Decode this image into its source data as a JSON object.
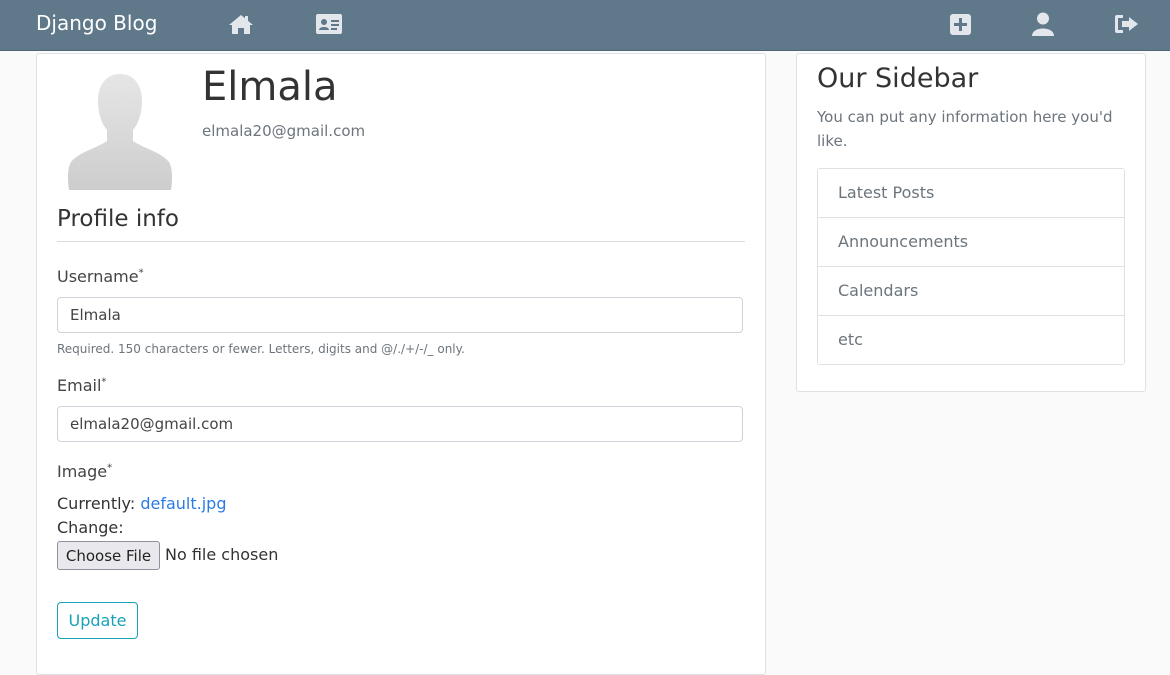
{
  "navbar": {
    "brand": "Django Blog",
    "icons": [
      "home-icon",
      "contact-card-icon",
      "plus-square-icon",
      "user-icon",
      "sign-out-icon"
    ],
    "bg_color": "#5f788a"
  },
  "profile": {
    "name": "Elmala",
    "email": "elmala20@gmail.com"
  },
  "form": {
    "legend": "Profile info",
    "username_label": "Username",
    "required_mark": "*",
    "username_value": "Elmala",
    "username_help": "Required. 150 characters or fewer. Letters, digits and @/./+/-/_ only.",
    "email_label": "Email",
    "email_value": "elmala20@gmail.com",
    "image_label": "Image",
    "currently_label": "Currently:",
    "current_file": "default.jpg",
    "change_label": "Change:",
    "choose_file_label": "Choose File",
    "no_file_text": "No file chosen",
    "submit_label": "Update",
    "accent_color": "#17a2b8"
  },
  "sidebar": {
    "title": "Our Sidebar",
    "text": "You can put any information here you'd like.",
    "items": [
      "Latest Posts",
      "Announcements",
      "Calendars",
      "etc"
    ]
  }
}
